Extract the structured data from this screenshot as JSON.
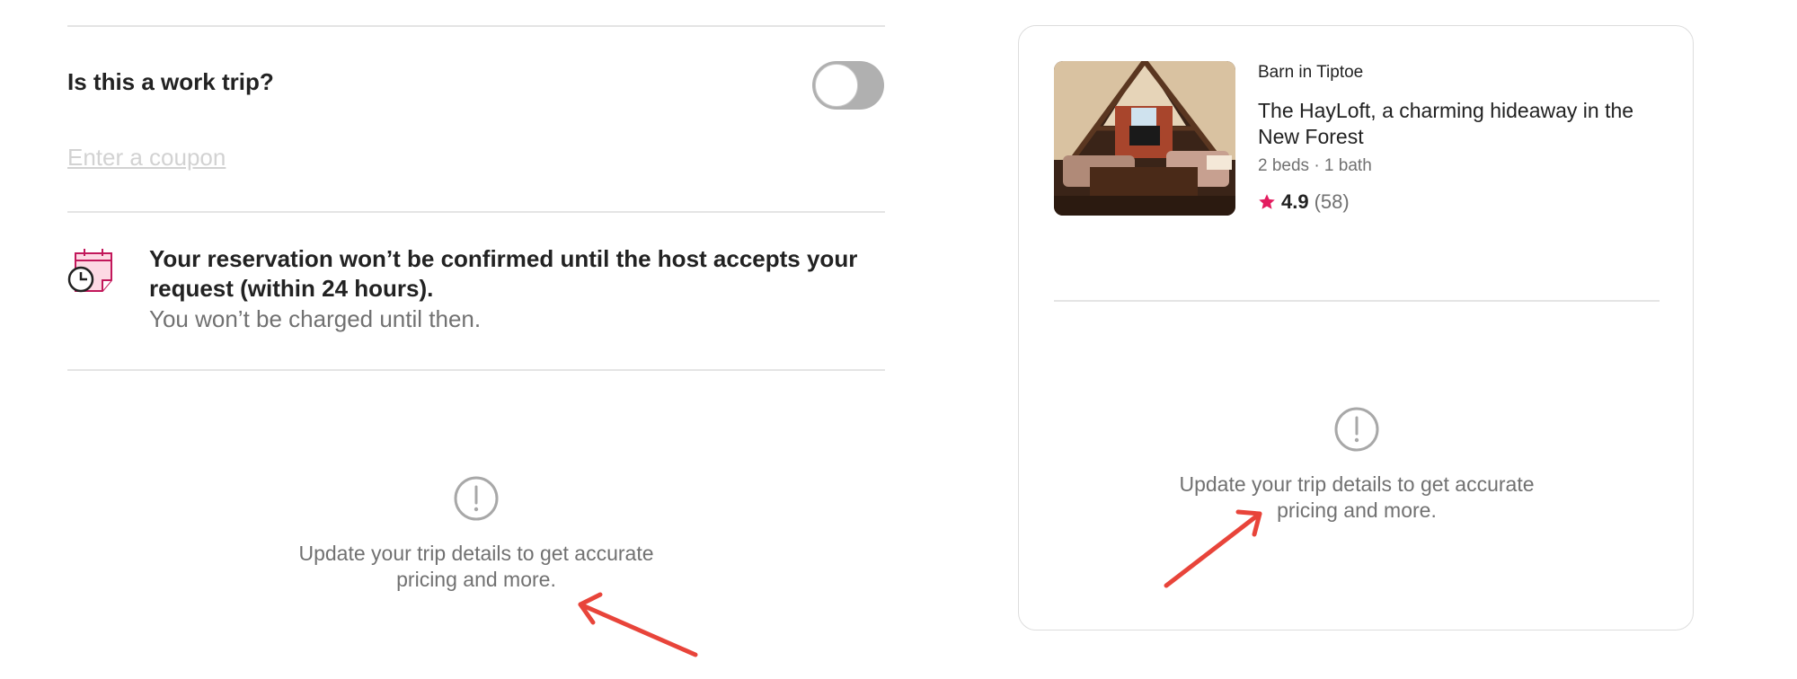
{
  "work_trip": {
    "label": "Is this a work trip?",
    "toggle_on": false
  },
  "coupon": {
    "label": "Enter a coupon"
  },
  "reservation_notice": {
    "title": "Your reservation won’t be confirmed until the host accepts your request (within 24 hours).",
    "subtitle": "You won’t be charged until then.",
    "icon": "calendar-clock-icon"
  },
  "trip_details_alert": {
    "line1": "Update your trip details to get accurate",
    "line2": "pricing and more.",
    "icon": "exclamation-circle-icon"
  },
  "listing_card": {
    "type": "Barn in Tiptoe",
    "name": "The HayLoft, a charming hideaway in the New Forest",
    "details": "2 beds · 1 bath",
    "rating": "4.9",
    "review_count": "(58)",
    "alert": {
      "line1": "Update your trip details to get accurate",
      "line2": "pricing and more.",
      "icon": "exclamation-circle-icon"
    }
  },
  "colors": {
    "accent": "#e31c5f",
    "annotation_arrow": "#e8443a",
    "muted_text": "#717171",
    "divider": "#e4e4e4"
  }
}
